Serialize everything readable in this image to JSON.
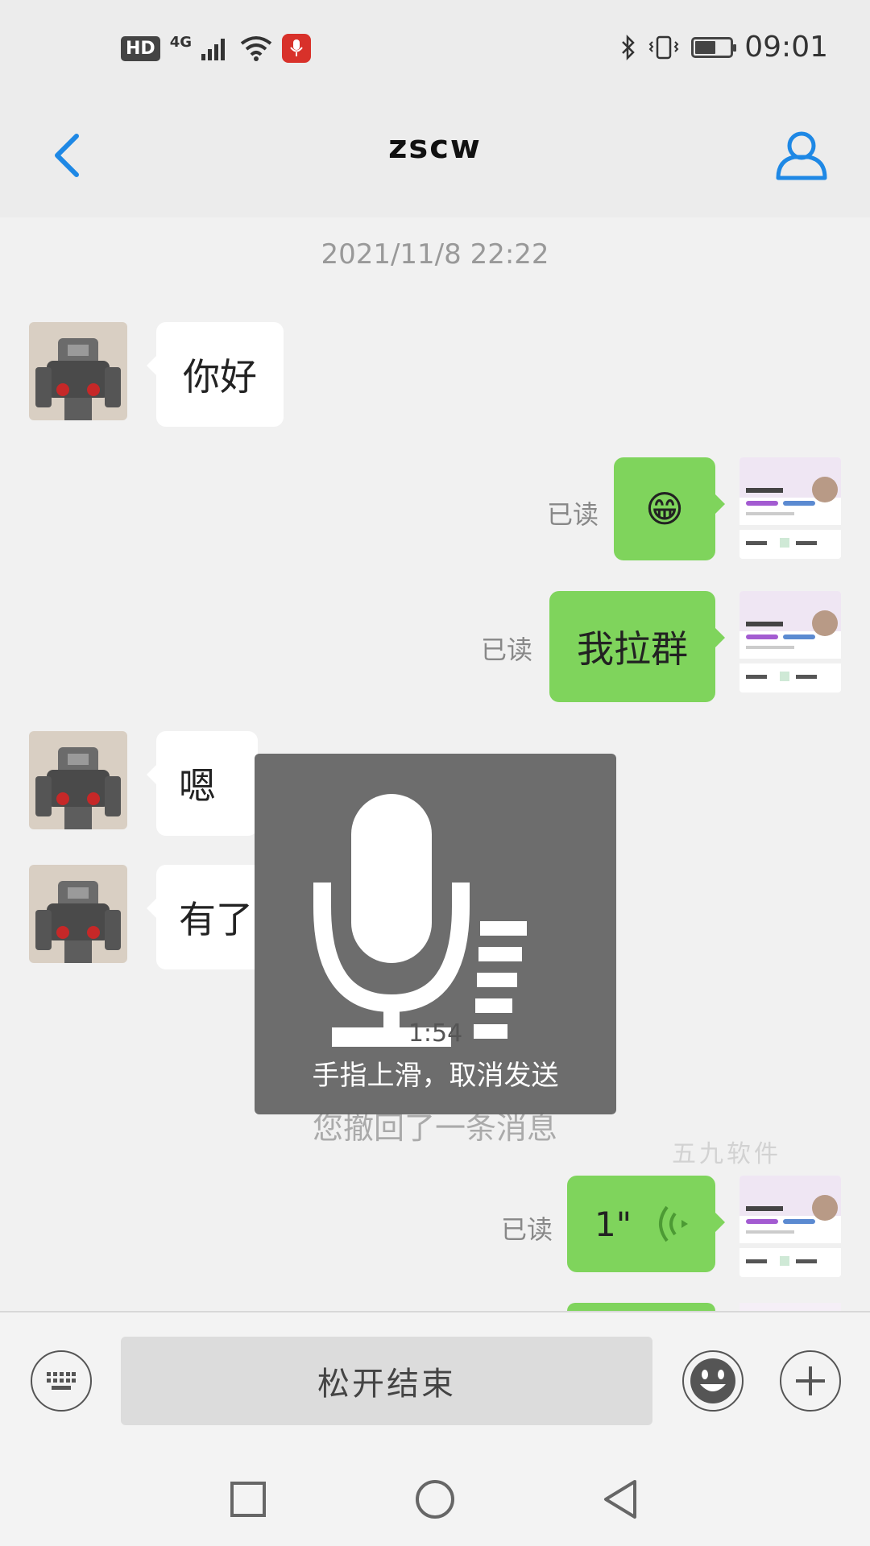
{
  "status_bar": {
    "hd_badge": "HD",
    "network": "4G",
    "time": "09:01",
    "battery_level": 0.6,
    "icons": [
      "signal-icon",
      "wifi-icon",
      "recording-mic-icon",
      "bluetooth-icon",
      "vibrate-icon",
      "battery-icon"
    ]
  },
  "header": {
    "title": "zscw"
  },
  "chat": {
    "timestamp": "2021/11/8 22:22",
    "messages": [
      {
        "side": "in",
        "text": "你好"
      },
      {
        "side": "out",
        "text": "😁",
        "status": "已读"
      },
      {
        "side": "out",
        "text": "我拉群",
        "status": "已读"
      },
      {
        "side": "in",
        "text": "嗯"
      },
      {
        "side": "in",
        "text": "有了"
      },
      {
        "side": "out",
        "text": "1\"",
        "status": "已读"
      }
    ],
    "revoked_notice": "您撤回了一条消息",
    "watermark": "五九软件"
  },
  "recording_overlay": {
    "elapsed": "1:54",
    "hint": "手指上滑，取消发送"
  },
  "input_bar": {
    "hold_label": "松开结束"
  },
  "colors": {
    "accent": "#1e88e5",
    "outgoing_bubble": "#7fd45c",
    "incoming_bubble": "#ffffff",
    "recording_badge": "#d8312a"
  }
}
